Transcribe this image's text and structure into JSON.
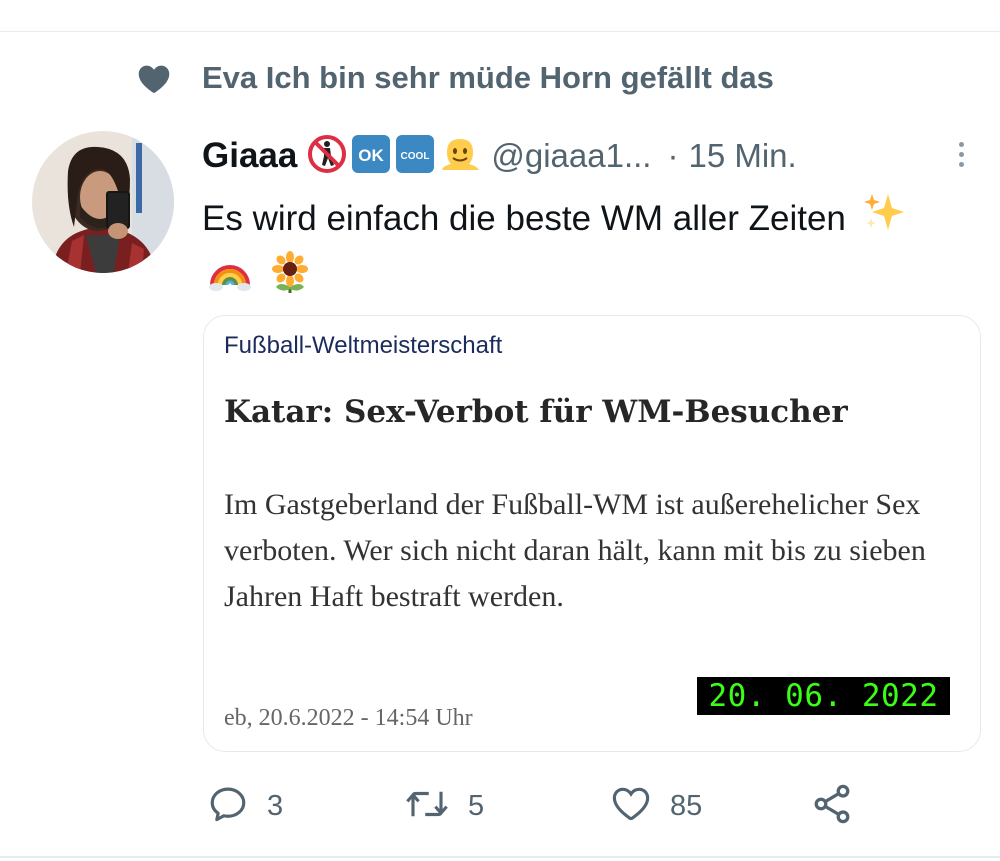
{
  "social_context": {
    "text": "Eva Ich bin sehr müde Horn gefällt das",
    "icon": "heart-icon"
  },
  "tweet": {
    "display_name": "Giaaa",
    "name_emojis": [
      "no-pedestrians-emoji",
      "ok-button-emoji",
      "cool-button-emoji",
      "melting-face-emoji"
    ],
    "ok_label": "OK",
    "cool_label": "COOL",
    "handle": "@giaaa1...",
    "separator": "·",
    "timestamp": "15 Min.",
    "text": "Es wird einfach die beste WM aller Zeiten",
    "text_emojis": [
      "sparkles-emoji",
      "rainbow-emoji",
      "sunflower-emoji"
    ]
  },
  "card": {
    "kicker": "Fußball-Weltmeisterschaft",
    "title": "Katar: Sex-Verbot für WM-Besucher",
    "body": "Im Gastgeberland der Fußball-WM ist außerehelicher Sex verboten. Wer sich nicht daran hält, kann mit bis zu sieben Jahren Haft bestraft werden.",
    "meta": "eb, 20.6.2022 - 14:54 Uhr"
  },
  "overlay": {
    "date_stamp": "20. 06. 2022",
    "text_color": "#39ff14"
  },
  "actions": {
    "reply_count": "3",
    "retweet_count": "5",
    "like_count": "85"
  },
  "colors": {
    "secondary_text": "#536471",
    "primary_text": "#0f1419",
    "border": "#e6e9ec"
  }
}
